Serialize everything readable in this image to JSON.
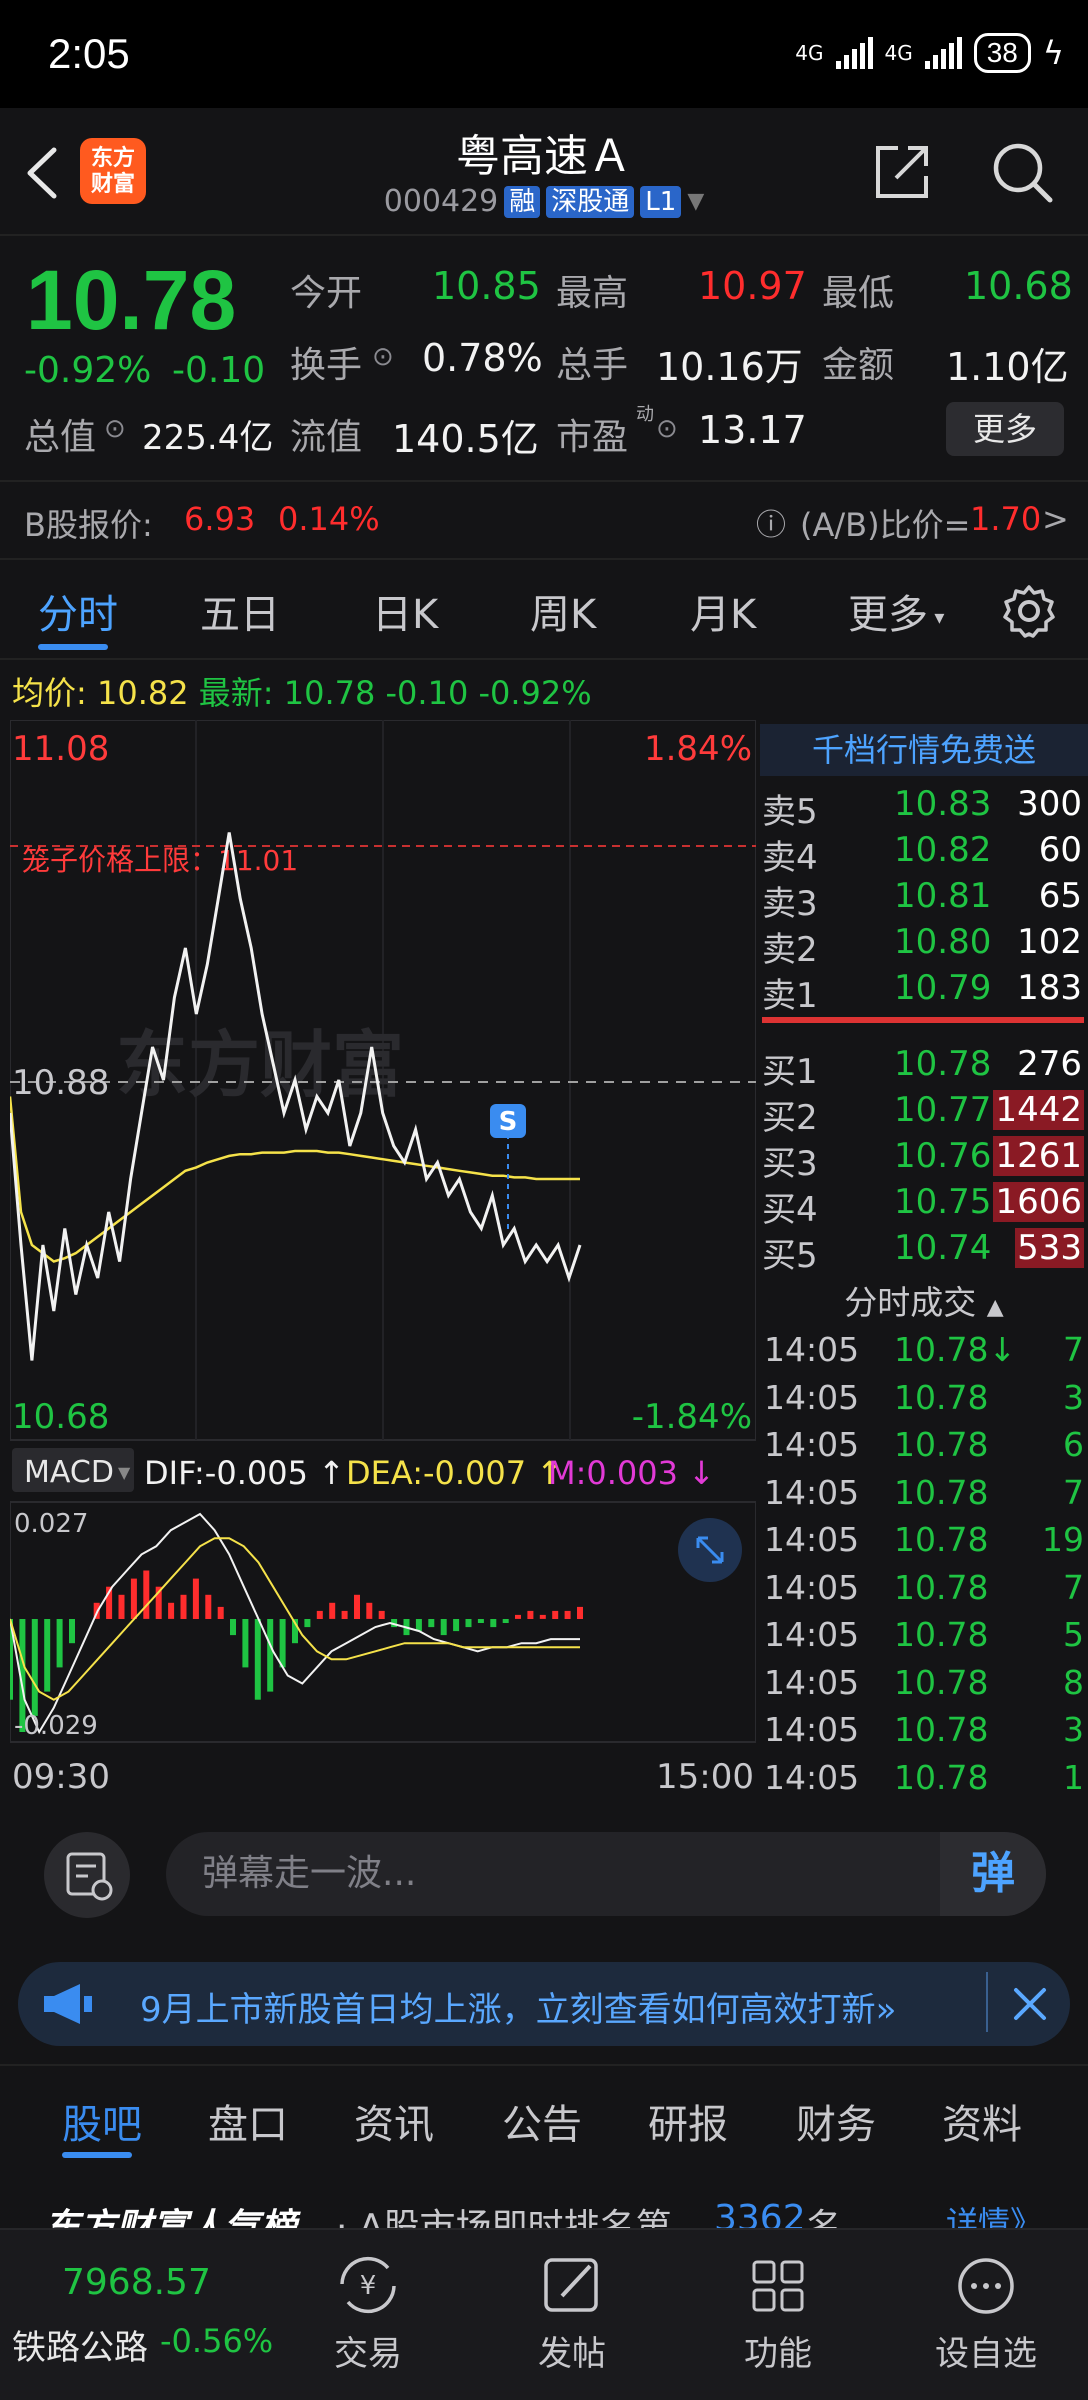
{
  "status_bar": {
    "time": "2:05",
    "network1": "4G",
    "network2": "4G",
    "battery": "38"
  },
  "header": {
    "logo_text_line1": "东方",
    "logo_text_line2": "财富",
    "stock_name": "粤高速Ａ",
    "stock_code": "000429",
    "tags": [
      "融",
      "深股通",
      "L1"
    ]
  },
  "quote": {
    "price": "10.78",
    "change_pct": "-0.92%",
    "change": "-0.10",
    "open_label": "今开",
    "open": "10.85",
    "high_label": "最高",
    "high": "10.97",
    "low_label": "最低",
    "low": "10.68",
    "turnover_label": "换手",
    "turnover": "0.78%",
    "volume_label": "总手",
    "volume": "10.16万",
    "amount_label": "金额",
    "amount": "1.10亿",
    "mktcap_label": "总值",
    "mktcap": "225.4亿",
    "float_label": "流值",
    "float_cap": "140.5亿",
    "pe_label": "市盈",
    "pe_sup": "动",
    "pe": "13.17",
    "more_label": "更多"
  },
  "b_share": {
    "label": "B股报价:",
    "price": "6.93",
    "pct": "0.14%",
    "ratio_label": "(A/B)比价=",
    "ratio": "1.70",
    "arrow": ">"
  },
  "tabs": [
    "分时",
    "五日",
    "日K",
    "周K",
    "月K",
    "更多"
  ],
  "info_line": {
    "avg_label": "均价:",
    "avg": "10.82",
    "latest_label": "最新:",
    "latest": "10.78",
    "chg": "-0.10",
    "pct": "-0.92%"
  },
  "chart": {
    "top_price": "11.08",
    "top_pct": "1.84%",
    "bottom_price": "10.68",
    "bottom_pct": "-1.84%",
    "mid_price": "10.88",
    "limit_label": "笼子价格上限：11.01",
    "watermark": "东方财富",
    "marker": "S",
    "time_start": "09:30",
    "time_end": "15:00",
    "macd_label": "MACD",
    "dif": "DIF:-0.005",
    "dea": "DEA:-0.007",
    "m": "M:0.003",
    "macd_top": "0.027",
    "macd_bottom": "-0.029"
  },
  "chart_data": {
    "type": "line",
    "title": "",
    "ylim": [
      10.68,
      11.08
    ],
    "reference_price": 10.88,
    "limit_price": 11.01,
    "xlim": [
      "09:30",
      "15:00"
    ],
    "series": [
      {
        "name": "",
        "color": "#f0f0f0",
        "values": [
          10.86,
          10.78,
          10.71,
          10.78,
          10.74,
          10.79,
          10.75,
          10.78,
          10.76,
          10.8,
          10.77,
          10.82,
          10.86,
          10.9,
          10.88,
          10.93,
          10.96,
          10.92,
          10.95,
          10.99,
          11.03,
          10.99,
          10.96,
          10.92,
          10.89,
          10.86,
          10.88,
          10.85,
          10.87,
          10.86,
          10.88,
          10.84,
          10.86,
          10.9,
          10.86,
          10.84,
          10.83,
          10.85,
          10.82,
          10.83,
          10.81,
          10.82,
          10.8,
          10.79,
          10.81,
          10.78,
          10.79,
          10.77,
          10.78,
          10.77,
          10.78,
          10.76,
          10.78
        ]
      },
      {
        "name": "均价",
        "color": "#f5e24a",
        "values": [
          10.87,
          10.8,
          10.78,
          10.775,
          10.77,
          10.772,
          10.775,
          10.78,
          10.785,
          10.79,
          10.795,
          10.8,
          10.805,
          10.81,
          10.815,
          10.82,
          10.825,
          10.827,
          10.83,
          10.832,
          10.834,
          10.835,
          10.835,
          10.836,
          10.836,
          10.836,
          10.837,
          10.837,
          10.837,
          10.836,
          10.836,
          10.835,
          10.834,
          10.833,
          10.832,
          10.831,
          10.83,
          10.829,
          10.828,
          10.827,
          10.826,
          10.825,
          10.824,
          10.823,
          10.822,
          10.822,
          10.821,
          10.821,
          10.82,
          10.82,
          10.82,
          10.82,
          10.82
        ]
      }
    ],
    "macd_hist": [
      -0.02,
      -0.028,
      -0.024,
      -0.018,
      -0.012,
      -0.006,
      0.0,
      0.004,
      0.008,
      0.006,
      0.01,
      0.012,
      0.008,
      0.004,
      0.006,
      0.01,
      0.006,
      0.003,
      -0.004,
      -0.012,
      -0.02,
      -0.018,
      -0.012,
      -0.006,
      -0.002,
      0.002,
      0.004,
      0.002,
      0.006,
      0.004,
      0.002,
      -0.002,
      -0.004,
      -0.003,
      -0.002,
      -0.004,
      -0.003,
      -0.002,
      -0.001,
      -0.002,
      -0.001,
      0.001,
      0.002,
      0.001,
      0.002,
      0.002,
      0.003
    ],
    "macd_dif": [
      0.0,
      -0.02,
      -0.028,
      -0.022,
      -0.014,
      -0.006,
      0.002,
      0.008,
      0.012,
      0.016,
      0.018,
      0.022,
      0.024,
      0.026,
      0.022,
      0.016,
      0.008,
      0.0,
      -0.008,
      -0.014,
      -0.016,
      -0.012,
      -0.008,
      -0.006,
      -0.004,
      -0.002,
      -0.001,
      -0.002,
      -0.003,
      -0.005,
      -0.006,
      -0.007,
      -0.008,
      -0.007,
      -0.007,
      -0.006,
      -0.006,
      -0.005,
      -0.005,
      -0.005
    ],
    "macd_dea": [
      0.0,
      -0.012,
      -0.018,
      -0.02,
      -0.018,
      -0.014,
      -0.01,
      -0.006,
      -0.002,
      0.002,
      0.006,
      0.01,
      0.014,
      0.018,
      0.02,
      0.02,
      0.018,
      0.014,
      0.008,
      0.002,
      -0.004,
      -0.008,
      -0.01,
      -0.01,
      -0.009,
      -0.008,
      -0.007,
      -0.006,
      -0.006,
      -0.006,
      -0.006,
      -0.007,
      -0.007,
      -0.007,
      -0.007,
      -0.007,
      -0.007,
      -0.007,
      -0.007,
      -0.007
    ],
    "macd_ylim": [
      -0.029,
      0.027
    ]
  },
  "order_book": {
    "header": "千档行情免费送",
    "asks": [
      {
        "label": "卖5",
        "price": "10.83",
        "vol": "300",
        "hl": false
      },
      {
        "label": "卖4",
        "price": "10.82",
        "vol": "60",
        "hl": false
      },
      {
        "label": "卖3",
        "price": "10.81",
        "vol": "65",
        "hl": false
      },
      {
        "label": "卖2",
        "price": "10.80",
        "vol": "102",
        "hl": false
      },
      {
        "label": "卖1",
        "price": "10.79",
        "vol": "183",
        "hl": false
      }
    ],
    "bids": [
      {
        "label": "买1",
        "price": "10.78",
        "vol": "276",
        "hl": false
      },
      {
        "label": "买2",
        "price": "10.77",
        "vol": "1442",
        "hl": true
      },
      {
        "label": "买3",
        "price": "10.76",
        "vol": "1261",
        "hl": true
      },
      {
        "label": "买4",
        "price": "10.75",
        "vol": "1606",
        "hl": true
      },
      {
        "label": "买5",
        "price": "10.74",
        "vol": "533",
        "hl": true
      }
    ]
  },
  "trades": {
    "header": "分时成交",
    "rows": [
      {
        "time": "14:05",
        "price": "10.78↓",
        "vol": "7"
      },
      {
        "time": "14:05",
        "price": "10.78",
        "vol": "3"
      },
      {
        "time": "14:05",
        "price": "10.78",
        "vol": "6"
      },
      {
        "time": "14:05",
        "price": "10.78",
        "vol": "7"
      },
      {
        "time": "14:05",
        "price": "10.78",
        "vol": "19"
      },
      {
        "time": "14:05",
        "price": "10.78",
        "vol": "7"
      },
      {
        "time": "14:05",
        "price": "10.78",
        "vol": "5"
      },
      {
        "time": "14:05",
        "price": "10.78",
        "vol": "8"
      },
      {
        "time": "14:05",
        "price": "10.78",
        "vol": "3"
      },
      {
        "time": "14:05",
        "price": "10.78",
        "vol": "1"
      }
    ]
  },
  "danmu": {
    "placeholder": "弹幕走一波...",
    "button": "弹"
  },
  "banner": {
    "text": "9月上市新股首日均上涨，立刻查看如何高效打新»"
  },
  "subtabs": [
    "股吧",
    "盘口",
    "资讯",
    "公告",
    "研报",
    "财务",
    "资料"
  ],
  "ranking": {
    "title": "东方财富人气榜",
    "text": "· A股市场即时排名第",
    "rank": "3362",
    "suffix": "名",
    "detail": "详情》"
  },
  "bottom_nav": {
    "index_value": "7968.57",
    "index_name": "铁路公路",
    "index_pct": "-0.56%",
    "items": [
      "交易",
      "发帖",
      "功能",
      "设自选"
    ]
  },
  "colors": {
    "up": "#ff2d2d",
    "down": "#1fc443",
    "accent": "#3a8cf0",
    "avg_line": "#f5e24a"
  }
}
